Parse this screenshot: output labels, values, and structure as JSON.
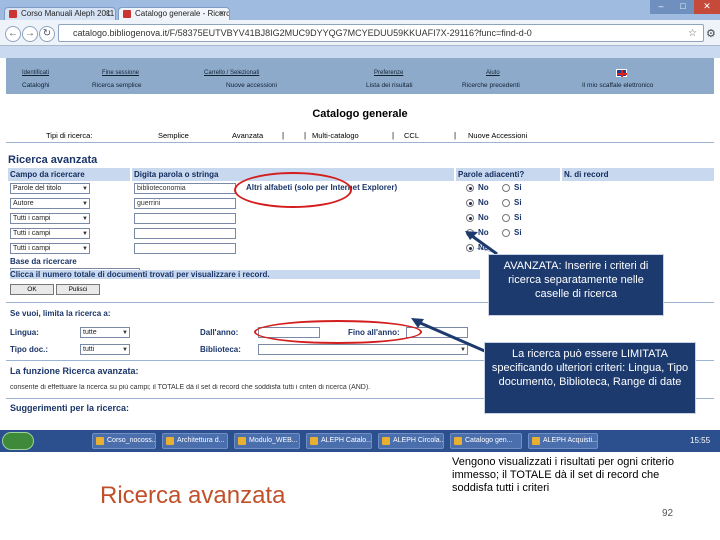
{
  "browser": {
    "tabs": [
      {
        "label": "Corso Manuali Aleph 2011"
      },
      {
        "label": "Catalogo generale - Ricerca"
      }
    ],
    "url": "catalogo.bibliogenova.it/F/58375EUTVBYV41BJ8IG2MUC9DYYQG7MCYEDUU59KKUAFI7X-29116?func=find-d-0",
    "accent_color": "#8eaacb"
  },
  "menubar": {
    "top_items": [
      "Identificati",
      "Fine sessione",
      "Carrello / Selezionati",
      "Preferenze",
      "Aiuto",
      "English"
    ],
    "bottom_items": [
      "Cataloghi",
      "Ricerca semplice",
      "Nuove accessioni",
      "Lista dei risultati",
      "Ricerche precedenti",
      "Il mio scaffale elettronico"
    ]
  },
  "page": {
    "catalog_title": "Catalogo generale",
    "search_types_label": "Tipi di ricerca:",
    "search_types": [
      "Semplice",
      "Avanzata",
      "Multi-catalogo",
      "CCL",
      "Nuove Accessioni"
    ],
    "section_title": "Ricerca avanzata",
    "columns": {
      "field": "Campo da ricercare",
      "words": "Digita parola o stringa",
      "adjacent": "Parole adiacenti?",
      "count": "N. di record"
    },
    "rows": [
      {
        "field": "Parole del titolo",
        "value": "biblioteconomia"
      },
      {
        "field": "Autore",
        "value": "guerrini"
      },
      {
        "field": "Tutti i campi",
        "value": ""
      },
      {
        "field": "Tutti i campi",
        "value": ""
      },
      {
        "field": "Tutti i campi",
        "value": ""
      }
    ],
    "radio_no": "No",
    "radio_si": "Si",
    "other_alphabets": "Altri alfabeti (solo per Internet Explorer)",
    "base_label": "Base da ricercare",
    "base_value": "",
    "count_instruction": "Clicca il numero totale di documenti trovati per visualizzare i record.",
    "btn_ok": "OK",
    "btn_cancel": "Pulisci",
    "limit_label": "Se vuoi, limita la ricerca a:",
    "limits": {
      "language_label": "Lingua:",
      "language_value": "tutte",
      "year_from_label": "Dall'anno:",
      "year_to_label": "Fino all'anno:",
      "doctype_label": "Tipo doc.:",
      "doctype_value": "tutti",
      "library_label": "Biblioteca:"
    },
    "function_title": "La funzione Ricerca avanzata:",
    "function_text": "consente di effettuare la ricerca su più campi; il TOTALE dà il set di record che soddisfa tutti i criteri di ricerca (AND).",
    "suggestions_title": "Suggerimenti per la ricerca:"
  },
  "callouts": {
    "avanzata": "AVANZATA: Inserire i criteri di ricerca separatamente nelle caselle di ricerca",
    "limitata": "La ricerca può essere LIMITATA specificando ulteriori criteri: Lingua, Tipo documento, Biblioteca, Range di date"
  },
  "taskbar": {
    "items": [
      "Corso_nocoss...",
      "Architettura d...",
      "Modulo_WEB...",
      "ALEPH Catalo...",
      "ALEPH Circola...",
      "Catalogo gen...",
      "ALEPH Acquisti..."
    ],
    "clock": "15:55"
  },
  "slide": {
    "title": "Ricerca avanzata",
    "note": "Vengono visualizzati i risultati per ogni criterio immesso; il TOTALE dà il set di record che soddisfa tutti i criteri",
    "number": "92",
    "title_color": "#c0502a",
    "callout_color": "#1c3a6e"
  }
}
